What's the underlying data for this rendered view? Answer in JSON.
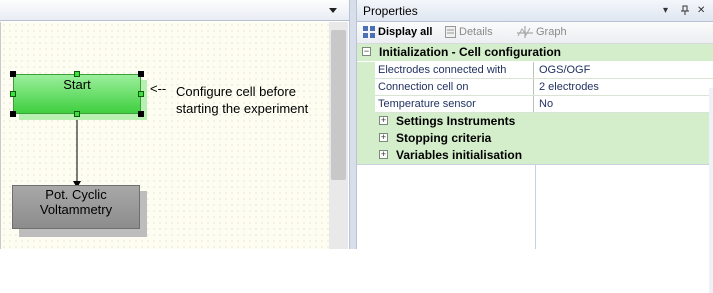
{
  "canvas": {
    "start_node_label": "Start",
    "annotation_arrow": "<--",
    "annotation_text": "Configure cell before starting the experiment",
    "cv_node_label": "Pot. Cyclic Voltammetry"
  },
  "properties_panel": {
    "title": "Properties",
    "controls": {
      "dropdown": "▾",
      "pin": "ᵖ",
      "close": "✕"
    },
    "toolbar": {
      "display_all": "Display all",
      "details": "Details",
      "graph": "Graph"
    },
    "category": {
      "label": "Initialization - Cell configuration",
      "expander": "−"
    },
    "properties": [
      {
        "name": "Electrodes connected with",
        "value": "OGS/OGF"
      },
      {
        "name": "Connection cell on",
        "value": "2 electrodes"
      },
      {
        "name": "Temperature sensor",
        "value": "No"
      }
    ],
    "groups": [
      {
        "label": "Settings Instruments",
        "expander": "+"
      },
      {
        "label": "Stopping criteria",
        "expander": "+"
      },
      {
        "label": "Variables initialisation",
        "expander": "+"
      }
    ]
  },
  "colors": {
    "category_bg": "#d4eecb",
    "start_node": "#3fcf3f",
    "cv_node": "#8c8c8c"
  }
}
